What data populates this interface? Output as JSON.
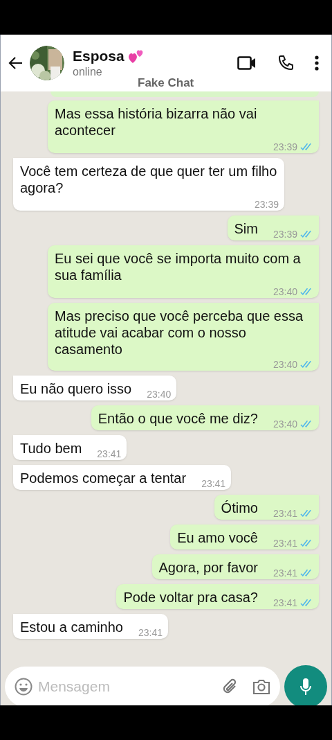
{
  "header": {
    "contact_name": "Esposa",
    "presence": "online",
    "app_label": "Fake Chat"
  },
  "messages": [
    {
      "kind": "sent",
      "text": "Mas essa história bizarra não vai acontecer",
      "time": "23:39",
      "read": true
    },
    {
      "kind": "received",
      "text": "Você tem certeza de que quer ter um filho agora?",
      "time": "23:39"
    },
    {
      "kind": "sent",
      "text": "Sim",
      "time": "23:39",
      "read": true
    },
    {
      "kind": "sent",
      "text": "Eu sei que você se importa muito com a sua família",
      "time": "23:40",
      "read": true
    },
    {
      "kind": "sent",
      "text": "Mas preciso que você perceba que essa atitude vai acabar com o nosso casamento",
      "time": "23:40",
      "read": true
    },
    {
      "kind": "received",
      "text": "Eu não quero isso",
      "time": "23:40"
    },
    {
      "kind": "sent",
      "text": "Então o que você me diz?",
      "time": "23:40",
      "read": true
    },
    {
      "kind": "received",
      "text": "Tudo bem",
      "time": "23:41"
    },
    {
      "kind": "received",
      "text": "Podemos começar a tentar",
      "time": "23:41"
    },
    {
      "kind": "sent",
      "text": "Ótimo",
      "time": "23:41",
      "read": true
    },
    {
      "kind": "sent",
      "text": "Eu amo você",
      "time": "23:41",
      "read": true
    },
    {
      "kind": "sent",
      "text": "Agora, por favor",
      "time": "23:41",
      "read": true
    },
    {
      "kind": "sent",
      "text": "Pode voltar pra casa?",
      "time": "23:41",
      "read": true
    },
    {
      "kind": "received",
      "text": "Estou a caminho",
      "time": "23:41"
    }
  ],
  "composer": {
    "placeholder": "Mensagem"
  }
}
